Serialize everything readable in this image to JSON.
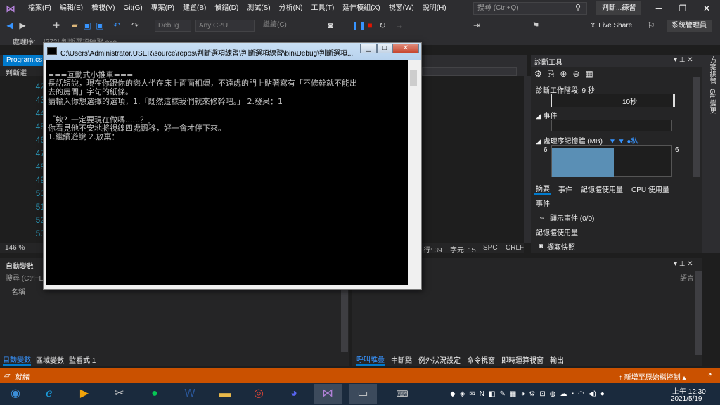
{
  "menubar": {
    "items": [
      "檔案(F)",
      "編輯(E)",
      "檢視(V)",
      "Git(G)",
      "專案(P)",
      "建置(B)",
      "偵錯(D)",
      "測試(S)",
      "分析(N)",
      "工具(T)",
      "延伸模組(X)",
      "視窗(W)",
      "說明(H)"
    ],
    "search_placeholder": "搜尋 (Ctrl+Q)",
    "solution_title": "判斷...練習"
  },
  "toolbar": {
    "config": "Debug",
    "platform": "Any CPU",
    "continue_label": "繼續(C)",
    "live_share": "Live Share",
    "admin": "系統管理員"
  },
  "process_bar": {
    "label": "處理序:",
    "value": "[272] 判斷選項練習.exe"
  },
  "editor": {
    "tab": "Program.cs",
    "nav_text": "判斷選",
    "line_numbers": [
      "42",
      "43",
      "44",
      "45",
      "46",
      "47",
      "48",
      "49",
      "50",
      "51",
      "52",
      "53"
    ],
    "zoom": "146 %",
    "status_line": "行: 39",
    "status_col": "字元: 15",
    "status_spc": "SPC",
    "status_crlf": "CRLF"
  },
  "diagnostics": {
    "title": "診斷工具",
    "session": "診斷工作階段: 9 秒",
    "timeline_mark": "10秒",
    "events_label": "◢ 事件",
    "memory_label": "◢ 處理序記憶體 (MB)",
    "memory_legend": "▼ ▼ ●私...",
    "memory_left": "6",
    "memory_right": "6",
    "tabs": [
      "摘要",
      "事件",
      "記憶體使用量",
      "CPU 使用量"
    ],
    "section_events": "事件",
    "show_events": "顯示事件 (0/0)",
    "section_memory": "記憶體使用量",
    "snapshot": "擷取快照"
  },
  "sidestrip": {
    "item1": "方案總管",
    "item2": "Git 變更"
  },
  "autos": {
    "title": "自動變數",
    "search": "搜尋 (Ctrl+E)",
    "column": "名稱",
    "tabs": [
      "自動變數",
      "區域變數",
      "監看式 1"
    ]
  },
  "immediate": {
    "lang": "語言",
    "tabs": [
      "呼叫堆疊",
      "中斷點",
      "例外狀況設定",
      "命令視窗",
      "即時運算視窗",
      "輸出"
    ]
  },
  "statusbar": {
    "ready": "就緒",
    "source_control": "↑ 新增至原始檔控制 ▴"
  },
  "taskbar": {
    "time": "上午 12:30",
    "date": "2021/5/19"
  },
  "console": {
    "title": "C:\\Users\\Administrator.USER\\source\\repos\\判斷選項練習\\判斷選項練習\\bin\\Debug\\判斷選項...",
    "lines": [
      "===互動式小推車===",
      "長話短說，現在你跟你的戀人坐在床上面面相覷，不遠處的門上貼著寫有「不修幹就不能出",
      "去的房間」字句的紙條。",
      "請輸入你想選擇的選項，1.「既然這樣我們就來修幹吧。」 2.發呆：1",
      "",
      "「欸？一定要現在做嗎......？」",
      "你看見他不安地將視線四處飄移，好一會才停下來。",
      "1.繼續遊說 2.放棄："
    ]
  },
  "colors": {
    "accent": "#007acc",
    "statusbar": "#ca5100",
    "background": "#1e1e1e",
    "chrome": "#2d2d30"
  }
}
